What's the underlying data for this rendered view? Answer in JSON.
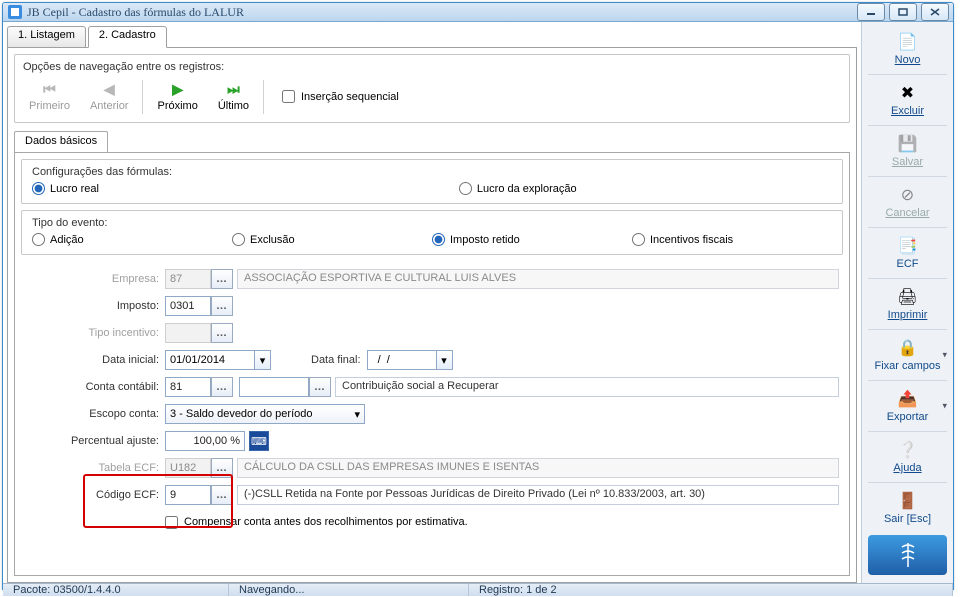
{
  "title": "JB Cepil - Cadastro das fórmulas do LALUR",
  "tabs": {
    "one": "1. Listagem",
    "two": "2. Cadastro"
  },
  "nav": {
    "label": "Opções de navegação entre os registros:",
    "first": "Primeiro",
    "prev": "Anterior",
    "next": "Próximo",
    "last": "Último",
    "seq": "Inserção sequencial"
  },
  "subtab": "Dados básicos",
  "config": {
    "label": "Configurações das fórmulas:",
    "opt1": "Lucro real",
    "opt2": "Lucro da exploração"
  },
  "tipo": {
    "label": "Tipo do evento:",
    "opt1": "Adição",
    "opt2": "Exclusão",
    "opt3": "Imposto retido",
    "opt4": "Incentivos fiscais"
  },
  "fields": {
    "empresa_lbl": "Empresa:",
    "empresa_val": "87",
    "empresa_desc": "ASSOCIAÇÃO ESPORTIVA E CULTURAL LUIS ALVES",
    "imposto_lbl": "Imposto:",
    "imposto_val": "0301",
    "ti_lbl": "Tipo incentivo:",
    "di_lbl": "Data inicial:",
    "di_val": "01/01/2014",
    "df_lbl": "Data final:",
    "df_val": "  /  /",
    "cc_lbl": "Conta contábil:",
    "cc_val": "81",
    "cc_desc": "Contribuição social a Recuperar",
    "escopo_lbl": "Escopo conta:",
    "escopo_val": "3 - Saldo devedor do período",
    "pa_lbl": "Percentual ajuste:",
    "pa_val": "100,00 %",
    "te_lbl": "Tabela ECF:",
    "te_val": "U182",
    "te_desc": "CÁLCULO DA CSLL DAS EMPRESAS IMUNES E ISENTAS",
    "ce_lbl": "Código ECF:",
    "ce_val": "9",
    "ce_desc": "(-)CSLL Retida na Fonte por Pessoas Jurídicas de Direito Privado (Lei nº 10.833/2003, art. 30)",
    "comp": "Compensar conta antes dos recolhimentos por estimativa."
  },
  "side": {
    "novo": "Novo",
    "excluir": "Excluir",
    "salvar": "Salvar",
    "cancelar": "Cancelar",
    "ecf": "ECF",
    "imprimir": "Imprimir",
    "fixar": "Fixar campos",
    "exportar": "Exportar",
    "ajuda": "Ajuda",
    "sair": "Sair [Esc]"
  },
  "status": {
    "pacote": "Pacote: 03500/1.4.4.0",
    "navegando": "Navegando...",
    "registro": "Registro: 1 de 2"
  }
}
